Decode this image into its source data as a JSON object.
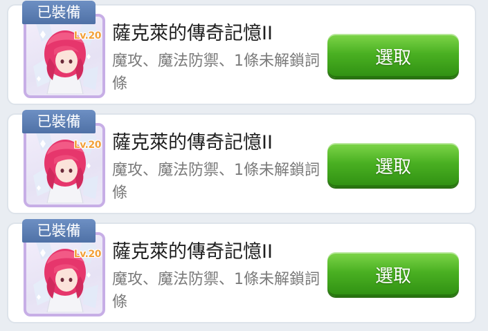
{
  "items": [
    {
      "tag": "已裝備",
      "level": "Lv.20",
      "title": "薩克萊的傳奇記憶II",
      "description": "魔攻、魔法防禦、1條未解鎖詞條",
      "button": "選取",
      "icon": "red-haired-character-portrait-icon"
    },
    {
      "tag": "已裝備",
      "level": "Lv.20",
      "title": "薩克萊的傳奇記憶II",
      "description": "魔攻、魔法防禦、1條未解鎖詞條",
      "button": "選取",
      "icon": "red-haired-character-portrait-icon"
    },
    {
      "tag": "已裝備",
      "level": "Lv.20",
      "title": "薩克萊的傳奇記憶II",
      "description": "魔攻、魔法防禦、1條未解鎖詞條",
      "button": "選取",
      "icon": "red-haired-character-portrait-icon"
    }
  ],
  "colors": {
    "tag_bg": "#5a7cb2",
    "frame_border": "#c7aee6",
    "level_text": "#f2a13a",
    "button_green": "#4ab022",
    "description_text": "#7a7a7a"
  }
}
